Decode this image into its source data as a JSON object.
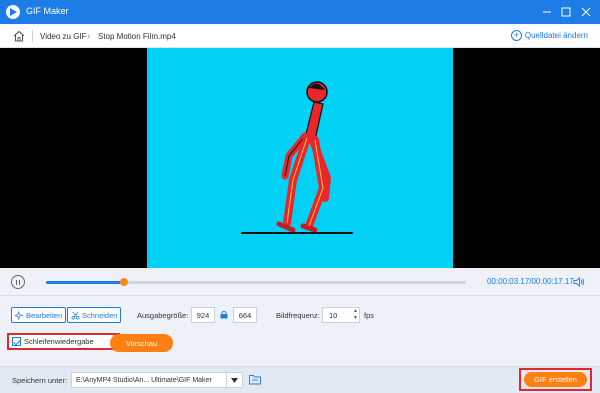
{
  "window": {
    "title": "GIF Maker"
  },
  "breadcrumb": {
    "items": [
      "Video zu GIF",
      "Stop Motion Film.mp4"
    ]
  },
  "header": {
    "change_source": "Quelldatei ändern"
  },
  "player": {
    "time": "00:00:03.17/00:00:17.17",
    "progress_fraction": 0.185
  },
  "controls": {
    "edit_label": "Bearbeiten",
    "cut_label": "Schneiden",
    "output_size_label": "Ausgabegröße:",
    "width": "924",
    "height": "664",
    "frame_rate_label": "Bildfrequenz:",
    "frame_rate": "10",
    "fps_unit": "fps",
    "loop_label": "Schleifenwiedergabe",
    "loop_checked": true,
    "preview_label": "Vorschau"
  },
  "footer": {
    "save_label": "Speichern unter:",
    "path": "E:\\AnyMP4 Studio\\An... Ultimate\\GIF Maker",
    "create_label": "GIF erstellen"
  },
  "colors": {
    "accent": "#1e7ce6",
    "orange": "#ff7f11",
    "highlight": "#e0282d",
    "video_bg": "#00d1f5"
  }
}
